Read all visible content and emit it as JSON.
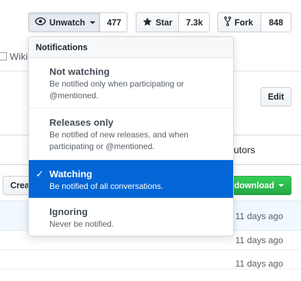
{
  "actions": {
    "watch": {
      "label": "Unwatch",
      "count": "477"
    },
    "star": {
      "label": "Star",
      "count": "7.3k"
    },
    "fork": {
      "label": "Fork",
      "count": "848"
    }
  },
  "repo_nav": {
    "wiki_label": "Wiki"
  },
  "background": {
    "edit_label": "Edit",
    "contributors_fragment": "ibutors",
    "create_fragment": "Crea",
    "download_label": "r download",
    "file_ages": [
      "11 days ago",
      "11 days ago",
      "11 days ago"
    ]
  },
  "notifications": {
    "header": "Notifications",
    "options": [
      {
        "title": "Not watching",
        "desc_line1": "Be notified only when participating or",
        "desc_line2": "@mentioned."
      },
      {
        "title": "Releases only",
        "desc_line1": "Be notified of new releases, and when",
        "desc_line2": "participating or @mentioned."
      },
      {
        "title": "Watching",
        "desc_line1": "Be notified of all conversations.",
        "desc_line2": ""
      },
      {
        "title": "Ignoring",
        "desc_line1": "Never be notified.",
        "desc_line2": ""
      }
    ],
    "selected_index": 2
  },
  "colors": {
    "selected_bg": "#0366d6",
    "download_green": "#28a745"
  },
  "icons": [
    "eye-icon",
    "star-icon",
    "fork-icon",
    "book-icon",
    "check-icon",
    "caret-down-icon"
  ]
}
